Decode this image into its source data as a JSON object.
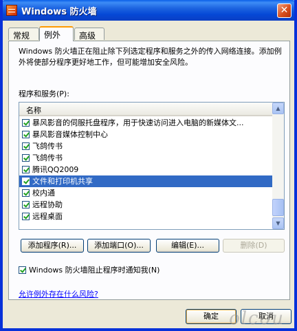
{
  "window": {
    "title": "Windows 防火墙",
    "close_glyph": "✕"
  },
  "tabs": [
    {
      "label": "常规"
    },
    {
      "label": "例外",
      "active": true
    },
    {
      "label": "高级"
    }
  ],
  "description": "Windows 防火墙正在阻止除下列选定程序和服务之外的传入网络连接。添加例外将使部分程序更好地工作，但可能增加安全风险。",
  "programs": {
    "label": "程序和服务(P):",
    "column_header": "名称",
    "items": [
      {
        "label": "暴风影音的伺服托盘程序，用于快速访问进入电脑的新媒体文...",
        "checked": true
      },
      {
        "label": "暴风影音媒体控制中心",
        "checked": true
      },
      {
        "label": "飞鸽传书",
        "checked": true
      },
      {
        "label": "飞鸽传书",
        "checked": true
      },
      {
        "label": "腾讯QQ2009",
        "checked": true
      },
      {
        "label": "文件和打印机共享",
        "checked": true,
        "selected": true
      },
      {
        "label": "校内通",
        "checked": true
      },
      {
        "label": "远程协助",
        "checked": true
      },
      {
        "label": "远程桌面",
        "checked": true
      }
    ]
  },
  "buttons": {
    "add_program": "添加程序(R)...",
    "add_port": "添加端口(O)...",
    "edit": "编辑(E)...",
    "delete": "删除(D)"
  },
  "notify": {
    "label": "Windows 防火墙阻止程序时通知我(N)",
    "checked": true
  },
  "risk_link": "允许例外存在什么风险?",
  "dialog": {
    "ok": "确定",
    "cancel": "取消"
  },
  "watermark": "olcou",
  "colors": {
    "titlebar": "#0548d6",
    "selection": "#316ac5",
    "link": "#0000ff",
    "face": "#ece9d8"
  }
}
